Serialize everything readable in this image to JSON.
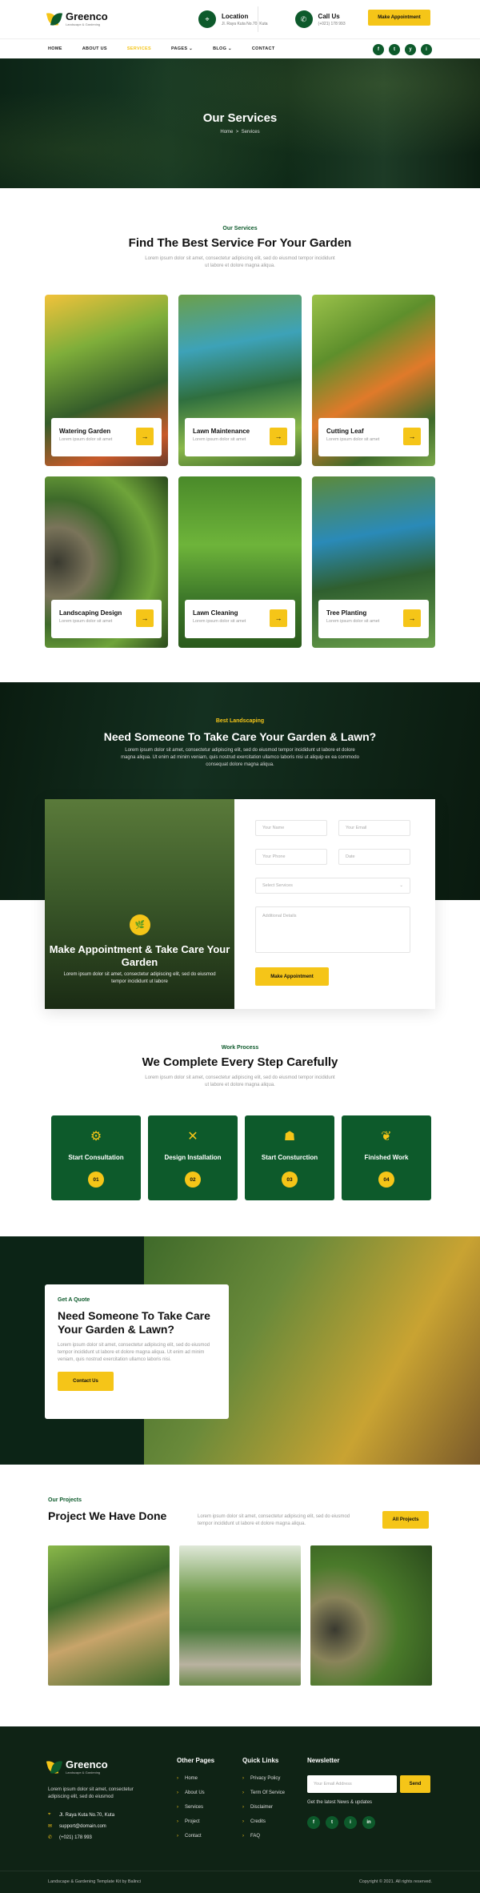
{
  "brand": {
    "name": "Greenco",
    "tagline": "Landscape & Gardening",
    "accent": "#f5c518",
    "primary": "#0d5a2b"
  },
  "header": {
    "location_title": "Location",
    "location_value": "Jl. Raya Kuta No.70, Kuta",
    "call_title": "Call Us",
    "call_value": "(+021) 178 993",
    "cta": "Make Appointment"
  },
  "nav": {
    "items": [
      "HOME",
      "ABOUT US",
      "SERVICES",
      "PAGES",
      "BLOG",
      "CONTACT"
    ],
    "active": "SERVICES",
    "socials": [
      "f",
      "t",
      "y",
      "i"
    ]
  },
  "hero": {
    "title": "Our Services",
    "crumb_home": "Home",
    "crumb_sep": ">",
    "crumb_current": "Services"
  },
  "services": {
    "subtitle": "Our Services",
    "title": "Find The Best Service For Your Garden",
    "description": "Lorem ipsum dolor sit amet, consectetur adipiscing elit, sed do eiusmod tempor incididunt ut labore et dolore magna aliqua.",
    "items": [
      {
        "name": "Watering Garden",
        "desc": "Lorem ipsum dolor sit amet"
      },
      {
        "name": "Lawn Maintenance",
        "desc": "Lorem ipsum dolor sit amet"
      },
      {
        "name": "Cutting Leaf",
        "desc": "Lorem ipsum dolor sit amet"
      },
      {
        "name": "Landscaping Design",
        "desc": "Lorem ipsum dolor sit amet"
      },
      {
        "name": "Lawn Cleaning",
        "desc": "Lorem ipsum dolor sit amet"
      },
      {
        "name": "Tree Planting",
        "desc": "Lorem ipsum dolor sit amet"
      }
    ]
  },
  "appointment": {
    "subtitle": "Best Landscaping",
    "title": "Need Someone To Take Care Your Garden & Lawn?",
    "description": "Lorem ipsum dolor sit amet, consectetur adipiscing elit, sed do eiusmod tempor incididunt ut labore et dolore magna aliqua. Ut enim ad minim veniam, quis nostrud exercitation ullamco laboris nisi ut aliquip ex ea commodo consequat dolore magna aliqua.",
    "card_title": "Make Appointment & Take Care Your Garden",
    "card_desc": "Lorem ipsum dolor sit amet, consectetur adipiscing elit, sed do eiusmod tempor incididunt ut labore",
    "form": {
      "name": "Your Name",
      "email": "Your Email",
      "phone": "Your Phone",
      "date": "Date",
      "services": "Select Services",
      "details": "Additional Details",
      "submit": "Make Appointment"
    }
  },
  "process": {
    "subtitle": "Work Process",
    "title": "We Complete Every Step Carefully",
    "description": "Lorem ipsum dolor sit amet, consectetur adipiscing elit, sed do eiusmod tempor incididunt ut labore et dolore magna aliqua.",
    "steps": [
      {
        "name": "Start Consultation",
        "num": "01"
      },
      {
        "name": "Design Installation",
        "num": "02"
      },
      {
        "name": "Start Consturction",
        "num": "03"
      },
      {
        "name": "Finished Work",
        "num": "04"
      }
    ]
  },
  "quote": {
    "subtitle": "Get A Quote",
    "title": "Need Someone To Take Care Your Garden & Lawn?",
    "description": "Lorem ipsum dolor sit amet, consectetur adipiscing elit, sed do eiusmod tempor incididunt ut labore et dolore magna aliqua. Ut enim ad minim veniam, quis nostrud exercitation ullamco laboris nisi.",
    "button": "Contact Us"
  },
  "projects": {
    "subtitle": "Our Projects",
    "title": "Project We Have Done",
    "description": "Lorem ipsum dolor sit amet, consectetur adipiscing elit, sed do eiusmod tempor incididunt ut labore et dolore magna aliqua.",
    "button": "All Projects"
  },
  "footer": {
    "description": "Lorem ipsum dolor sit amet, consectetur adipiscing elit, sed do eiusmod",
    "address": "Jl. Raya Kuta No.70, Kuta",
    "email": "support@domain.com",
    "phone": "(+021) 178 993",
    "other_title": "Other Pages",
    "other_links": [
      "Home",
      "About Us",
      "Services",
      "Project",
      "Contact"
    ],
    "quick_title": "Quick Links",
    "quick_links": [
      "Privacy Policy",
      "Term Of Service",
      "Disclaimer",
      "Credits",
      "FAQ"
    ],
    "newsletter_title": "Newsletter",
    "newsletter_placeholder": "Your Email Address",
    "newsletter_button": "Send",
    "newsletter_note": "Get the latest News & updates",
    "socials": [
      "f",
      "t",
      "i",
      "in"
    ],
    "copy_left": "Landscape & Gardening Template Kit by Balinci",
    "copy_right": "Copyright © 2021. All rights reserved."
  }
}
